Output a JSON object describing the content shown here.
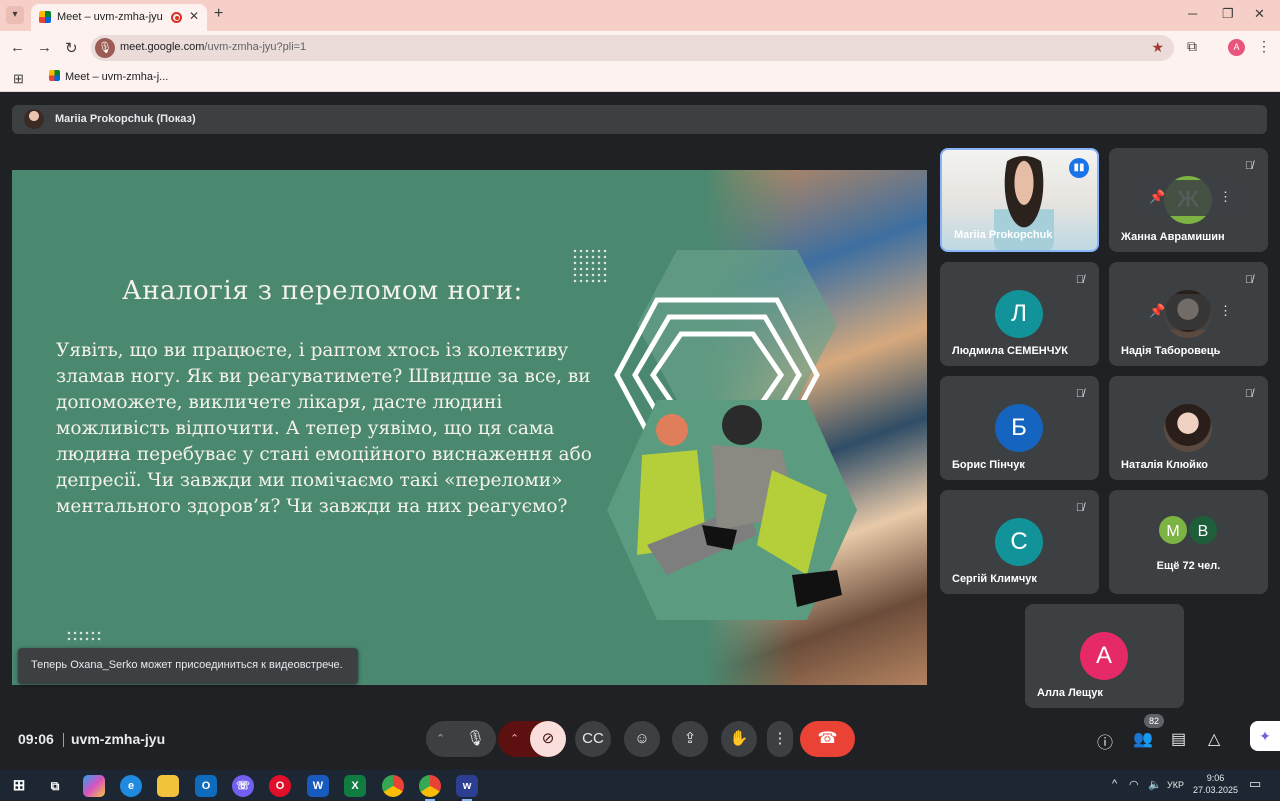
{
  "browser": {
    "tab_title": "Meet – uvm-zmha-jyu",
    "url_host": "meet.google.com",
    "url_path": "/uvm-zmha-jyu?pli=1",
    "profile_initial": "A",
    "bookmark_label": "Meet – uvm-zmha-j..."
  },
  "meet": {
    "presenter_label": "Mariia Prokopchuk (Показ)",
    "slide": {
      "title": "Аналогія з переломом ноги:",
      "body": " Уявіть, що ви працюєте, і раптом хтось із колективу зламав ногу. Як ви реагуватимете? Швидше за все, ви допоможете, викличете лікаря, дасте людині можливість відпочити. А тепер уявімо, що ця сама людина перебуває у стані емоційного виснаження або депресії. Чи завжди ми помічаємо такі «переломи» ментального здоров’я? Чи завжди на них реагуємо?"
    },
    "toast": "Теперь Oxana_Serko может присоединиться к видеовстрече.",
    "participants": [
      {
        "name": "Mariia Prokopchuk",
        "type": "video",
        "speaking": true
      },
      {
        "name": "Жанна Аврамишин",
        "initial": "Ж",
        "color": "#7cb342",
        "muted": true
      },
      {
        "name": "Людмила СЕМЕНЧУК",
        "initial": "Л",
        "color": "#12939a",
        "muted": true
      },
      {
        "name": "Надія Таборовець",
        "type": "photo",
        "muted": true
      },
      {
        "name": "Борис Пінчук",
        "initial": "Б",
        "color": "#1565c0",
        "muted": true
      },
      {
        "name": "Наталія Клюйко",
        "type": "photo",
        "muted": true
      },
      {
        "name": "Сергій Климчук",
        "initial": "С",
        "color": "#12939a",
        "muted": true
      },
      {
        "name": "Ещё 72 чел.",
        "initials": [
          "М",
          "В"
        ],
        "colors": [
          "#7cb342",
          "#1e5e3a"
        ]
      },
      {
        "name": "Алла Лещук",
        "initial": "А",
        "color": "#e52a67"
      }
    ],
    "time": "09:06",
    "meeting_code": "uvm-zmha-jyu",
    "participant_count": "82"
  },
  "taskbar": {
    "lang": "УКР",
    "time": "9:06",
    "date": "27.03.2025"
  },
  "icons": [
    "tab-list-icon",
    "meet-favicon",
    "record-icon",
    "close-icon",
    "plus-icon",
    "back-icon",
    "forward-icon",
    "reload-icon",
    "site-info-icon",
    "star-icon",
    "extensions-icon",
    "kebab-icon",
    "apps-icon",
    "mic-off-icon",
    "pin-icon",
    "mic-icon",
    "camera-off-icon",
    "captions-icon",
    "emoji-icon",
    "present-icon",
    "hand-icon",
    "hangup-icon",
    "info-icon",
    "people-icon",
    "chat-icon",
    "activities-icon",
    "gemini-icon"
  ]
}
